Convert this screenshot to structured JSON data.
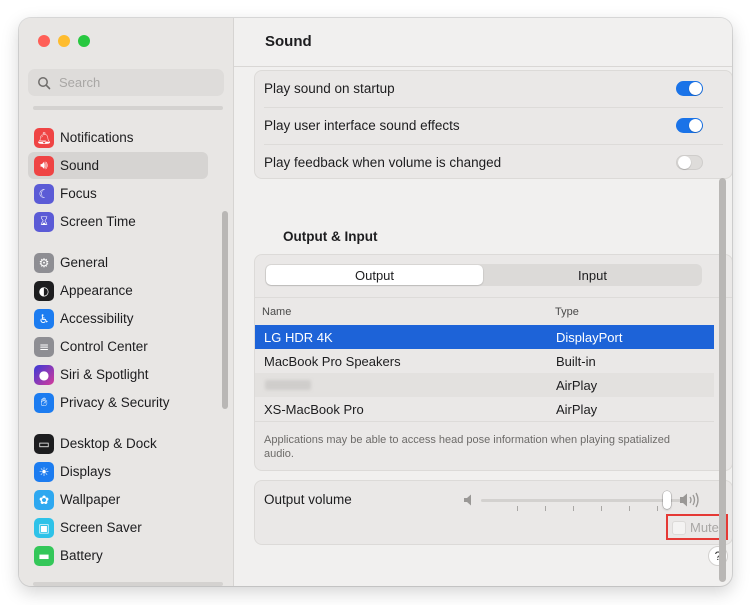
{
  "window": {
    "title": "Sound"
  },
  "colors": {
    "accent": "#1d63d8",
    "toggle_on": "#1a73e8",
    "highlight_border": "#e53935"
  },
  "search": {
    "placeholder": "Search",
    "value": ""
  },
  "sidebar": {
    "items": [
      {
        "label": "Notifications",
        "icon": "bell-icon",
        "color": "#ef4444"
      },
      {
        "label": "Sound",
        "icon": "speaker-icon",
        "color": "#ef4444",
        "selected": true
      },
      {
        "label": "Focus",
        "icon": "moon-icon",
        "color": "#5b5bd6"
      },
      {
        "label": "Screen Time",
        "icon": "hourglass-icon",
        "color": "#5b5bd6"
      },
      {
        "label": "General",
        "icon": "gear-icon",
        "color": "#8e8e93"
      },
      {
        "label": "Appearance",
        "icon": "appearance-icon",
        "color": "#1d1d1f"
      },
      {
        "label": "Accessibility",
        "icon": "accessibility-icon",
        "color": "#1c7cf0"
      },
      {
        "label": "Control Center",
        "icon": "toggles-icon",
        "color": "#8e8e93"
      },
      {
        "label": "Siri & Spotlight",
        "icon": "siri-icon",
        "color": "#b03ad6"
      },
      {
        "label": "Privacy & Security",
        "icon": "hand-icon",
        "color": "#1c7cf0"
      },
      {
        "label": "Desktop & Dock",
        "icon": "dock-icon",
        "color": "#1d1d1f"
      },
      {
        "label": "Displays",
        "icon": "sun-icon",
        "color": "#1c7cf0"
      },
      {
        "label": "Wallpaper",
        "icon": "flower-icon",
        "color": "#2ea8f0"
      },
      {
        "label": "Screen Saver",
        "icon": "screensaver-icon",
        "color": "#2ec2e8"
      },
      {
        "label": "Battery",
        "icon": "battery-icon",
        "color": "#34c759"
      }
    ]
  },
  "settings": {
    "startup": {
      "label": "Play sound on startup",
      "on": true
    },
    "ui_effects": {
      "label": "Play user interface sound effects",
      "on": true
    },
    "feedback": {
      "label": "Play feedback when volume is changed",
      "on": false
    }
  },
  "output_input": {
    "title": "Output & Input",
    "tabs": [
      "Output",
      "Input"
    ],
    "active_tab": "Output",
    "columns": [
      "Name",
      "Type"
    ],
    "rows": [
      {
        "name": "LG HDR 4K",
        "type": "DisplayPort",
        "selected": true
      },
      {
        "name": "MacBook Pro Speakers",
        "type": "Built-in"
      },
      {
        "name": "",
        "type": "AirPlay",
        "redacted": true
      },
      {
        "name": "XS-MacBook Pro",
        "type": "AirPlay"
      }
    ],
    "note": "Applications may be able to access head pose information when playing spatialized audio."
  },
  "volume": {
    "label": "Output volume",
    "level": 1.0
  },
  "mute": {
    "label": "Mute",
    "checked": false
  },
  "help": {
    "label": "?"
  }
}
